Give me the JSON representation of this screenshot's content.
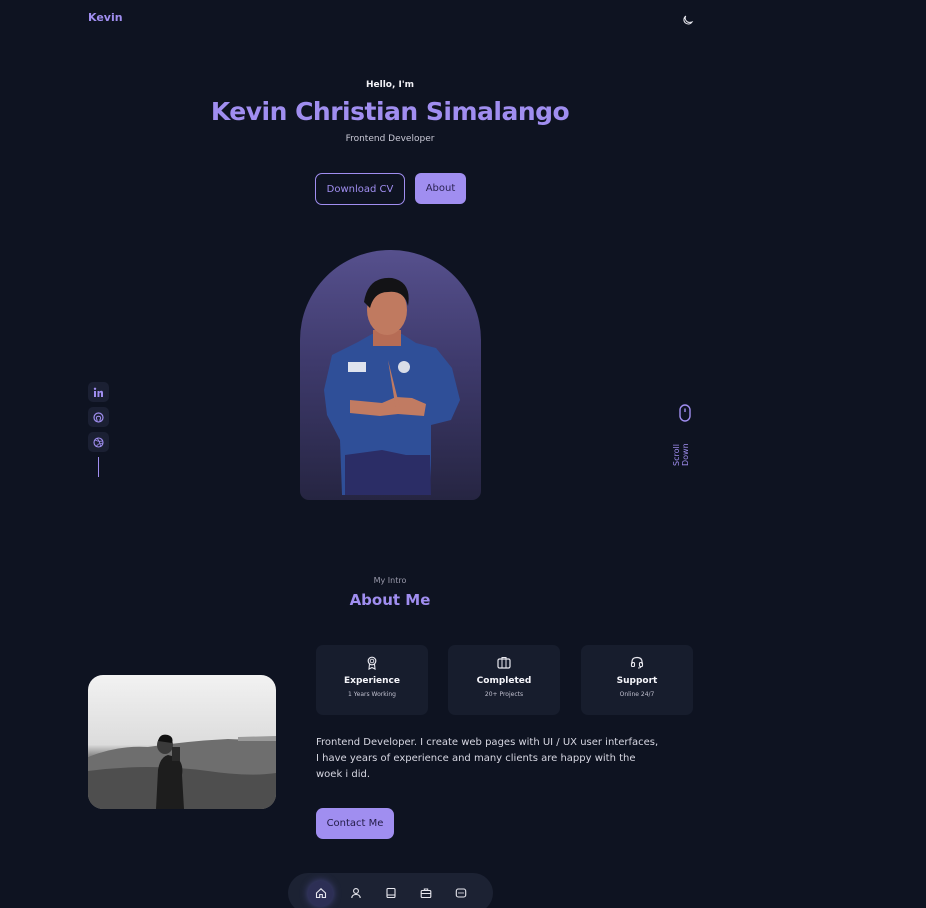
{
  "header": {
    "logo": "Kevin",
    "theme_icon": "moon-icon"
  },
  "hero": {
    "greeting": "Hello, I'm",
    "name": "Kevin Christian Simalango",
    "role": "Frontend Developer",
    "download_cv_label": "Download CV",
    "about_label": "About"
  },
  "socials": [
    {
      "icon": "linkedin-icon"
    },
    {
      "icon": "github-icon"
    },
    {
      "icon": "dribbble-icon"
    }
  ],
  "scroll": {
    "label": "Scroll Down",
    "icon": "mouse-icon"
  },
  "about": {
    "subtitle": "My Intro",
    "title": "About Me",
    "cards": [
      {
        "icon": "award-icon",
        "title": "Experience",
        "subtitle": "1 Years Working"
      },
      {
        "icon": "briefcase-icon",
        "title": "Completed",
        "subtitle": "20+ Projects"
      },
      {
        "icon": "headset-icon",
        "title": "Support",
        "subtitle": "Online 24/7"
      }
    ],
    "description": "Frontend Developer. I create web pages with UI / UX user interfaces, I have years of experience and many clients are happy with the woek i did.",
    "contact_label": "Contact Me"
  },
  "nav": [
    {
      "icon": "home-icon",
      "active": true
    },
    {
      "icon": "user-icon",
      "active": false
    },
    {
      "icon": "file-icon",
      "active": false
    },
    {
      "icon": "briefcase-icon",
      "active": false
    },
    {
      "icon": "message-icon",
      "active": false
    }
  ],
  "colors": {
    "background": "#0e1321",
    "accent": "#a08ef0",
    "card": "#171d2d"
  }
}
